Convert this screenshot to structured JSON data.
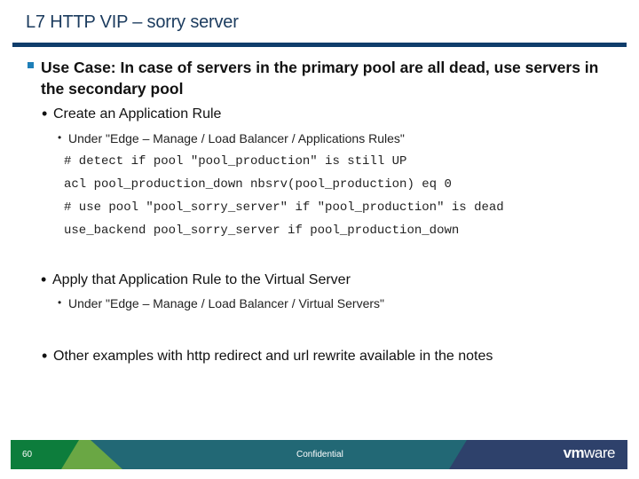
{
  "slide": {
    "title": "L7 HTTP VIP – sorry server",
    "bullet1": "Use Case: In case of servers in the primary pool are all dead, use servers in the secondary pool",
    "sub1": {
      "label": "Create an Application Rule",
      "note": "Under \"Edge – Manage /  Load Balancer / Applications Rules\"",
      "code": [
        "# detect if pool \"pool_production\" is still UP",
        "acl pool_production_down nbsrv(pool_production) eq 0",
        "# use pool \"pool_sorry_server\" if \"pool_production\" is dead",
        "use_backend pool_sorry_server if pool_production_down"
      ]
    },
    "sub2": {
      "label": "Apply that Application Rule to the Virtual Server",
      "note": "Under \"Edge – Manage /  Load Balancer / Virtual Servers\""
    },
    "sub3": {
      "label": "Other examples with http redirect and url rewrite available in the notes"
    }
  },
  "footer": {
    "page_number": "60",
    "confidential": "Confidential",
    "logo_text": "vmware",
    "colors": {
      "green": "#0d7d3c",
      "light_green": "#6aa744",
      "teal": "#226875",
      "navy": "#2e416b"
    }
  }
}
